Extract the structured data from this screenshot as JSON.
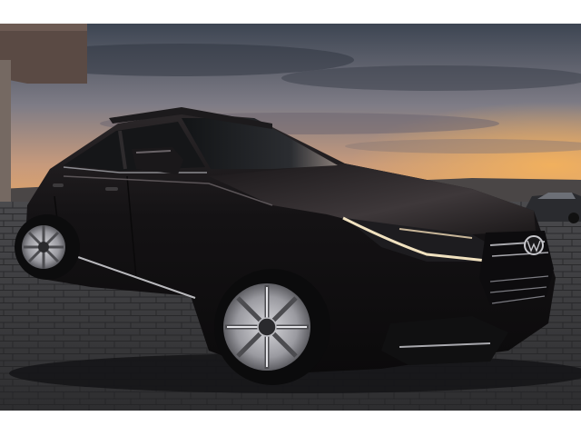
{
  "image": {
    "subject": "car-photo",
    "palette": {
      "sky_top": "#3d4552",
      "sky_mid": "#7e7c86",
      "horizon": "#e0a468",
      "sunset": "#f3b15c",
      "body": "#141214",
      "highlight": "#4a4548",
      "pavement": "#3b3b3d",
      "chrome": "#b9b9bd"
    }
  }
}
